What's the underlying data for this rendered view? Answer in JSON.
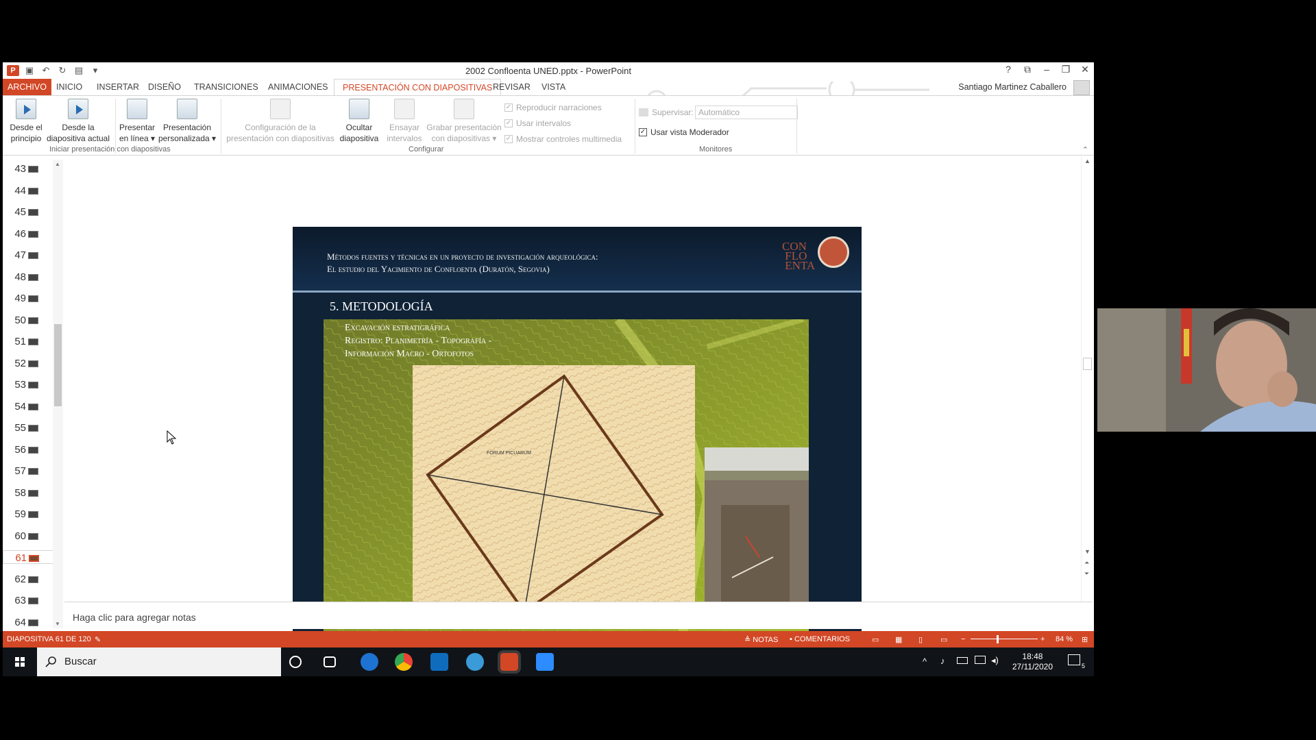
{
  "window": {
    "title": "2002 Confloenta UNED.pptx - PowerPoint",
    "user": "Santiago Martinez Caballero"
  },
  "tabs": [
    "ARCHIVO",
    "INICIO",
    "INSERTAR",
    "DISEÑO",
    "TRANSICIONES",
    "ANIMACIONES",
    "PRESENTACIÓN CON DIAPOSITIVAS",
    "REVISAR",
    "VISTA"
  ],
  "active_tab": "PRESENTACIÓN CON DIAPOSITIVAS",
  "ribbon": {
    "buttons": [
      {
        "line1": "Desde el",
        "line2": "principio"
      },
      {
        "line1": "Desde la",
        "line2": "diapositiva actual"
      },
      {
        "line1": "Presentar",
        "line2": "en línea ▾"
      },
      {
        "line1": "Presentación",
        "line2": "personalizada ▾"
      },
      {
        "line1": "Configuración de la",
        "line2": "presentación con diapositivas"
      },
      {
        "line1": "Ocultar",
        "line2": "diapositiva"
      },
      {
        "line1": "Ensayar",
        "line2": "intervalos"
      },
      {
        "line1": "Grabar presentación",
        "line2": "con diapositivas ▾"
      }
    ],
    "checkboxes": [
      "Reproducir narraciones",
      "Usar intervalos",
      "Mostrar controles multimedia"
    ],
    "monitor": {
      "supervise_label": "Supervisar:",
      "supervise_value": "Automático",
      "presenter_view": "Usar vista Moderador"
    },
    "groups": [
      "Iniciar presentación con diapositivas",
      "Configurar",
      "Monitores"
    ]
  },
  "thumbnails": [
    "43",
    "44",
    "45",
    "46",
    "47",
    "48",
    "49",
    "50",
    "51",
    "52",
    "53",
    "54",
    "55",
    "56",
    "57",
    "58",
    "59",
    "60",
    "61",
    "62",
    "63",
    "64"
  ],
  "selected_slide": "61",
  "slide": {
    "header_line1": "Métodos fuentes y técnicas en un proyecto de investigación arqueológica:",
    "header_line2": "El estudio del Yacimiento de Confloenta (Duratón, Segovia)",
    "logo_text": "CON FLO ENTA",
    "section": "5. METODOLOGÍA",
    "overlay": [
      "Excavación estratigráfica",
      "Registro: Planimetría - Topografía -",
      "Información Macro - Ortofotos"
    ],
    "map_label": "FORUM PICUARUM"
  },
  "notes_placeholder": "Haga clic para agregar notas",
  "status": {
    "slide_counter": "DIAPOSITIVA 61 DE 120",
    "notes": "NOTAS",
    "comments": "COMENTARIOS",
    "zoom": "84 %"
  },
  "taskbar": {
    "search": "Buscar",
    "time": "18:48",
    "date": "27/11/2020",
    "notif_count": "5"
  },
  "colors": {
    "accent": "#d24726",
    "slide_bg": "#0f2236"
  }
}
